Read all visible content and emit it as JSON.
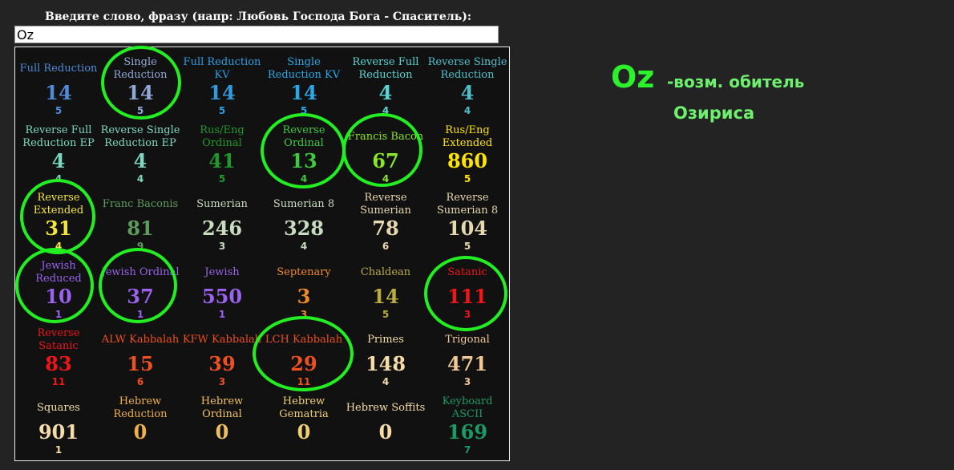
{
  "prompt_label": "Введите слово, фразу (напр: Любовь Господа Бога - Спаситель):",
  "search": {
    "value": "Oz"
  },
  "ciphers": [
    {
      "name": "Full Reduction",
      "value": "14",
      "sub": "5",
      "color": "#4f8bd8"
    },
    {
      "name": "Single Reduction",
      "value": "14",
      "sub": "5",
      "color": "#8fa8d8"
    },
    {
      "name": "Full Reduction KV",
      "value": "14",
      "sub": "5",
      "color": "#2d9de0"
    },
    {
      "name": "Single Reduction KV",
      "value": "14",
      "sub": "5",
      "color": "#2aa8e8"
    },
    {
      "name": "Reverse Full Reduction",
      "value": "4",
      "sub": "4",
      "color": "#5ad4d4"
    },
    {
      "name": "Reverse Single Reduction",
      "value": "4",
      "sub": "4",
      "color": "#4ec0cc"
    },
    {
      "name": "Reverse Full Reduction EP",
      "value": "4",
      "sub": "4",
      "color": "#7ad8c0"
    },
    {
      "name": "Reverse Single Reduction EP",
      "value": "4",
      "sub": "4",
      "color": "#80d8c4"
    },
    {
      "name": "Rus/Eng Ordinal",
      "value": "41",
      "sub": "5",
      "color": "#1f9a2a"
    },
    {
      "name": "Reverse Ordinal",
      "value": "13",
      "sub": "4",
      "color": "#3fca3f"
    },
    {
      "name": "Francis Bacon",
      "value": "67",
      "sub": "4",
      "color": "#8ae62a"
    },
    {
      "name": "Rus/Eng Extended",
      "value": "860",
      "sub": "5",
      "color": "#ffe400"
    },
    {
      "name": "Reverse Extended",
      "value": "31",
      "sub": "4",
      "color": "#f2e63a"
    },
    {
      "name": "Franc Baconis",
      "value": "81",
      "sub": "9",
      "color": "#5e9c5e"
    },
    {
      "name": "Sumerian",
      "value": "246",
      "sub": "3",
      "color": "#c8dcc0"
    },
    {
      "name": "Sumerian 8",
      "value": "328",
      "sub": "4",
      "color": "#c8dcc0"
    },
    {
      "name": "Reverse Sumerian",
      "value": "78",
      "sub": "6",
      "color": "#e8d8b0"
    },
    {
      "name": "Reverse Sumerian 8",
      "value": "104",
      "sub": "5",
      "color": "#e8d8b0"
    },
    {
      "name": "Jewish Reduced",
      "value": "10",
      "sub": "1",
      "color": "#9a62ee"
    },
    {
      "name": "Jewish Ordinal",
      "value": "37",
      "sub": "1",
      "color": "#9a62ee"
    },
    {
      "name": "Jewish",
      "value": "550",
      "sub": "1",
      "color": "#9a62ee"
    },
    {
      "name": "Septenary",
      "value": "3",
      "sub": "3",
      "color": "#f08a28"
    },
    {
      "name": "Chaldean",
      "value": "14",
      "sub": "5",
      "color": "#b8ac3c"
    },
    {
      "name": "Satanic",
      "value": "111",
      "sub": "3",
      "color": "#ee1616"
    },
    {
      "name": "Reverse Satanic",
      "value": "83",
      "sub": "11",
      "color": "#ee1616"
    },
    {
      "name": "ALW Kabbalah",
      "value": "15",
      "sub": "6",
      "color": "#ee5020"
    },
    {
      "name": "KFW Kabbalah",
      "value": "39",
      "sub": "3",
      "color": "#ee5020"
    },
    {
      "name": "LCH Kabbalah",
      "value": "29",
      "sub": "11",
      "color": "#ee5020"
    },
    {
      "name": "Primes",
      "value": "148",
      "sub": "4",
      "color": "#f5dca8"
    },
    {
      "name": "Trigonal",
      "value": "471",
      "sub": "3",
      "color": "#f0c896"
    },
    {
      "name": "Squares",
      "value": "901",
      "sub": "1",
      "color": "#f5dca8"
    },
    {
      "name": "Hebrew Reduction",
      "value": "0",
      "sub": "",
      "color": "#f0b048"
    },
    {
      "name": "Hebrew Ordinal",
      "value": "0",
      "sub": "",
      "color": "#f0c060"
    },
    {
      "name": "Hebrew Gematria",
      "value": "0",
      "sub": "",
      "color": "#f0d070"
    },
    {
      "name": "Hebrew Soffits",
      "value": "0",
      "sub": "",
      "color": "#f5dca8"
    },
    {
      "name": "Keyboard ASCII",
      "value": "169",
      "sub": "7",
      "color": "#1a9a64"
    }
  ],
  "annotation": {
    "title": "Oz",
    "line1": "-возм. обитель",
    "line2": "Озириса",
    "accent": "#2cf22c"
  }
}
